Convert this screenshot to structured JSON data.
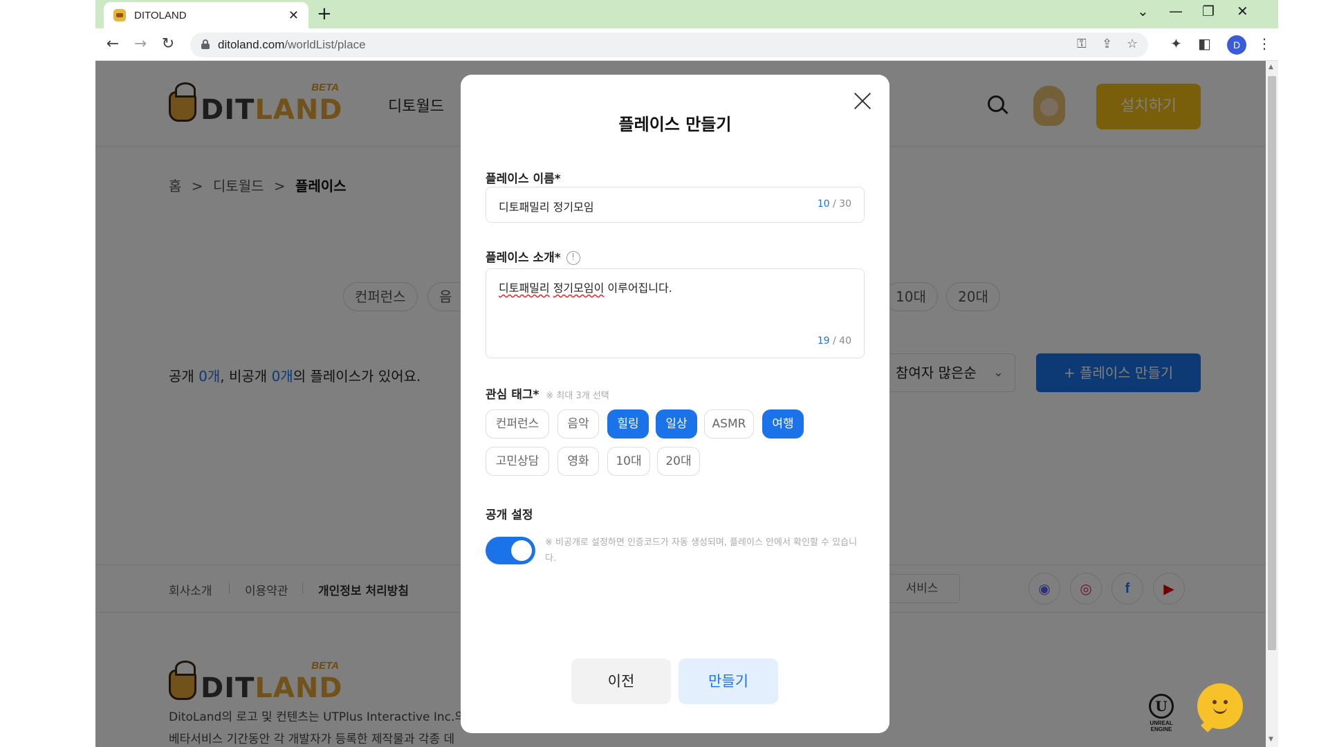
{
  "browser": {
    "tab_title": "DITOLAND",
    "url_host": "ditoland.com",
    "url_path": "/worldList/place",
    "profile_initial": "D"
  },
  "header": {
    "logo_beta": "BETA",
    "logo_word_a": "DIT",
    "logo_word_b": "LAND",
    "nav_item": "디토월드",
    "install_label": "설치하기"
  },
  "breadcrumb": [
    "홈",
    ">",
    "디토월드",
    ">",
    "플레이스"
  ],
  "bg_chips": [
    "컨퍼런스",
    "음악",
    "10대",
    "20대"
  ],
  "counts": {
    "public_label": "공개 ",
    "public_count": "0개",
    "private_label": ", 비공개 ",
    "private_count": "0개",
    "suffix": "의 플레이스가 있어요."
  },
  "sort": {
    "selected": "참여자 많은순"
  },
  "create_place_label": "+ 플레이스 만들기",
  "footer": {
    "links": [
      "회사소개",
      "이용약관",
      "개인정보 처리방침"
    ],
    "service_label": "서비스",
    "legal_1": "DitoLand의 로고 및 컨텐츠는 UTPlus Interactive Inc.의",
    "legal_2": "베타서비스 기간동안 각 개발자가 등록한 제작물과 각종 데",
    "unreal_caption": "UNREAL ENGINE"
  },
  "modal": {
    "title": "플레이스 만들기",
    "name_label": "플레이스 이름*",
    "name_value": "디토패밀리 정기모임",
    "name_count": "10",
    "name_max": " / 30",
    "intro_label": "플레이스 소개*",
    "intro_value_a": "디토패밀리",
    "intro_value_b": " ",
    "intro_value_c": "정기모임이",
    "intro_value_d": " 이루어집니다.",
    "intro_count": "19",
    "intro_max": " / 40",
    "tags_label": "관심 태그*",
    "tags_hint": "※ 최대 3개 선택",
    "tags": [
      {
        "label": "컨퍼런스",
        "selected": false
      },
      {
        "label": "음악",
        "selected": false
      },
      {
        "label": "힐링",
        "selected": true
      },
      {
        "label": "일상",
        "selected": true
      },
      {
        "label": "ASMR",
        "selected": false
      },
      {
        "label": "여행",
        "selected": true
      },
      {
        "label": "고민상담",
        "selected": false
      },
      {
        "label": "영화",
        "selected": false
      },
      {
        "label": "10대",
        "selected": false
      },
      {
        "label": "20대",
        "selected": false
      }
    ],
    "visibility_label": "공개 설정",
    "visibility_on": true,
    "visibility_note": "※ 비공개로 설정하면 인증코드가 자동 생성되며, 플레이스 안에서 확인할 수 있습니다.",
    "prev_label": "이전",
    "create_label": "만들기"
  },
  "colors": {
    "accent": "#1a73e8",
    "install": "#f5bf16",
    "tab_strip": "#cce8c4"
  }
}
